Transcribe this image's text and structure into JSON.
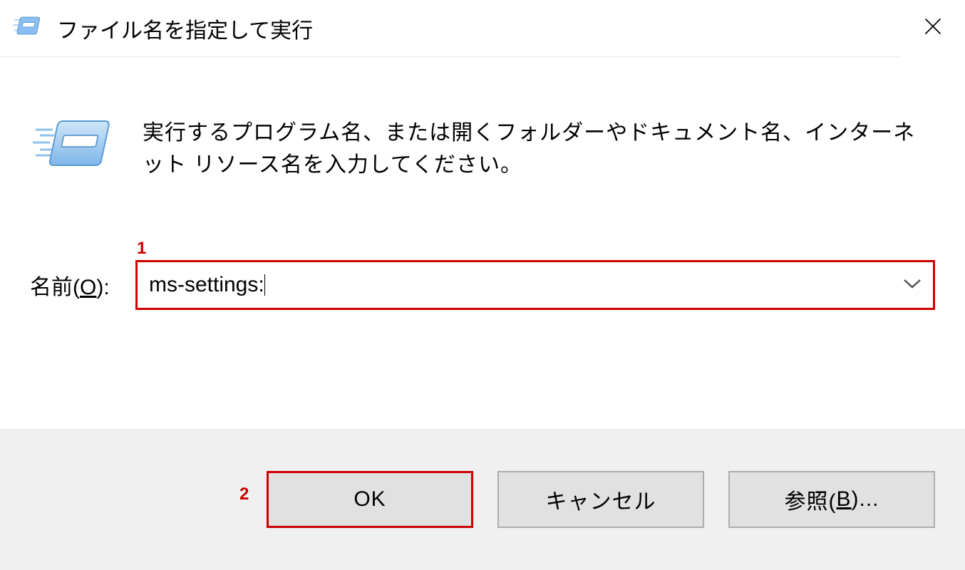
{
  "titlebar": {
    "title": "ファイル名を指定して実行"
  },
  "description": "実行するプログラム名、または開くフォルダーやドキュメント名、インターネット リソース名を入力してください。",
  "form": {
    "label_prefix": "名前(",
    "label_key": "O",
    "label_suffix": "):",
    "value": "ms-settings:"
  },
  "buttons": {
    "ok": "OK",
    "cancel": "キャンセル",
    "browse_prefix": "参照(",
    "browse_key": "B",
    "browse_suffix": ")..."
  },
  "annotations": {
    "a1": "1",
    "a2": "2"
  }
}
